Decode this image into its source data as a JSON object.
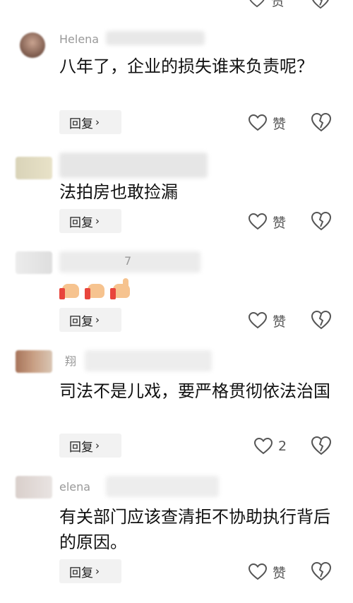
{
  "colors": {
    "text": "#111111",
    "meta": "#999999",
    "reply_bg": "#f2f2f2",
    "icon": "#555555"
  },
  "comments": [
    {
      "name": "Helena",
      "text": "八年了，企业的损失谁来负责呢？",
      "reply": "回复",
      "like": "赞"
    },
    {
      "name": "",
      "text": "法拍房也敢捡漏",
      "reply": "回复",
      "like": "赞"
    },
    {
      "name": "7",
      "emojis": [
        "fist-icon",
        "fist-icon",
        "thumbs-up-icon"
      ],
      "reply": "回复",
      "like": "赞"
    },
    {
      "name": "翔",
      "text": "司法不是儿戏，要严格贯彻依法治国",
      "reply": "回复",
      "like": "2"
    },
    {
      "name": "elena",
      "text": "有关部门应该查清拒不协助执行背后的原因。",
      "reply": "回复",
      "like": "赞"
    }
  ],
  "top_like": "赞"
}
